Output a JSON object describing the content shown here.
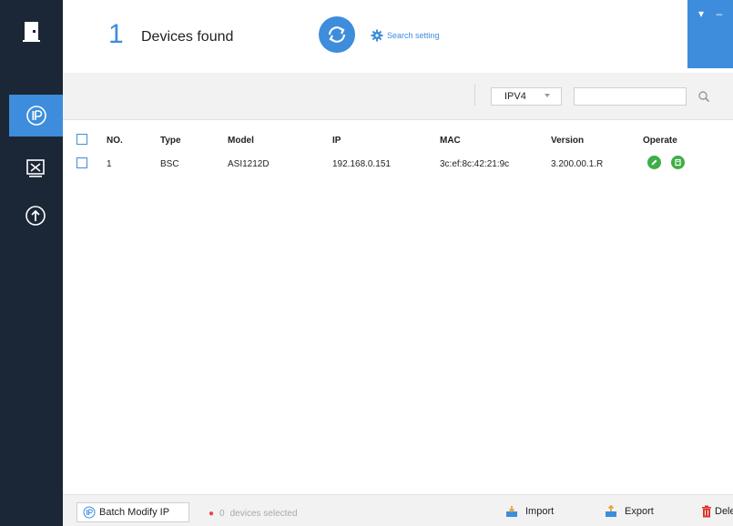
{
  "header": {
    "device_count": "1",
    "found_label": "Devices found",
    "search_setting_label": "Search setting"
  },
  "toolbar": {
    "ip_version": "IPV4",
    "search_value": ""
  },
  "table": {
    "columns": {
      "no": "NO.",
      "type": "Type",
      "model": "Model",
      "ip": "IP",
      "mac": "MAC",
      "version": "Version",
      "operate": "Operate"
    },
    "rows": [
      {
        "no": "1",
        "type": "BSC",
        "model": "ASI1212D",
        "ip": "192.168.0.151",
        "mac": "3c:ef:8c:42:21:9c",
        "version": "3.200.00.1.R"
      }
    ]
  },
  "footer": {
    "batch_modify_label": "Batch Modify IP",
    "selected_count": "0",
    "selected_label": "devices selected",
    "import_label": "Import",
    "export_label": "Export",
    "delete_label": "Dele"
  },
  "icons": {
    "sidebar": [
      "door-icon",
      "ip-icon",
      "tools-icon",
      "upgrade-icon"
    ],
    "edit": "edit-icon",
    "web": "web-icon"
  },
  "colors": {
    "accent": "#3d8ddc",
    "sidebar": "#1b2636",
    "operate": "#3fae45",
    "delete": "#d9342b"
  }
}
